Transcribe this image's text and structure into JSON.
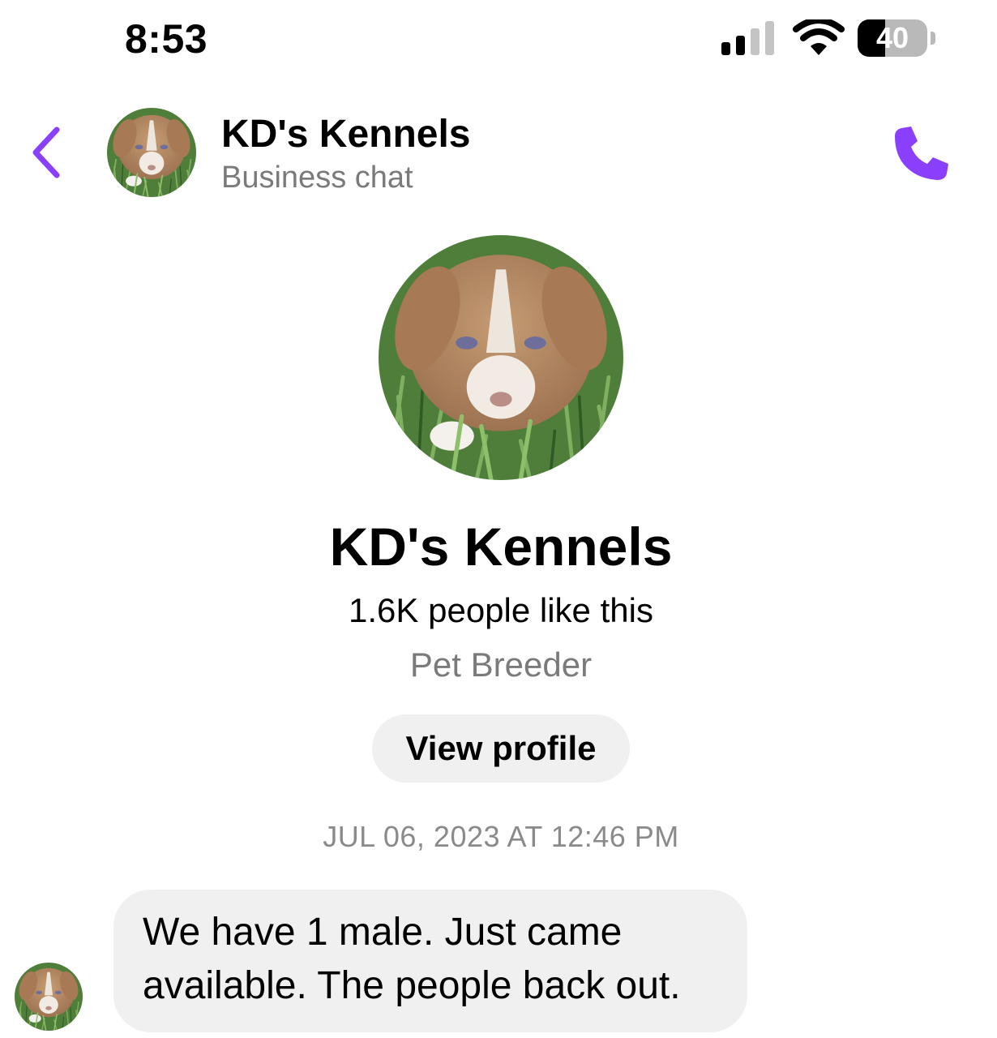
{
  "status_bar": {
    "time": "8:53",
    "battery": "40",
    "battery_level_percent": 40,
    "signal_bars": 2
  },
  "header": {
    "title": "KD's Kennels",
    "subtitle": "Business chat"
  },
  "profile": {
    "name": "KD's Kennels",
    "likes": "1.6K people like this",
    "category": "Pet Breeder",
    "view_profile_label": "View profile"
  },
  "conversation": {
    "timestamp": "JUL 06, 2023 AT 12:46 PM",
    "messages": [
      {
        "sender": "business",
        "text": "We have 1 male. Just came available. The people back out."
      }
    ]
  },
  "colors": {
    "accent": "#8a3ffc",
    "bubble": "#f0f0f0",
    "secondary_text": "#7a7a7a"
  }
}
